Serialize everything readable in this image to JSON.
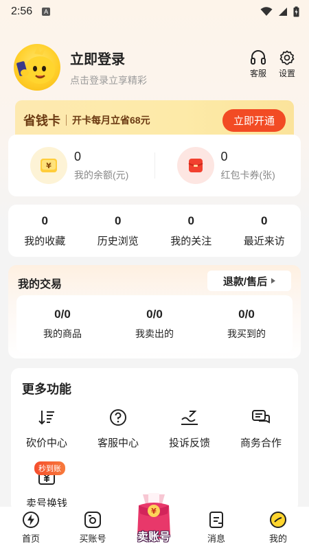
{
  "status_bar": {
    "time": "2:56",
    "notif_letter": "A"
  },
  "profile": {
    "title": "立即登录",
    "subtitle": "点击登录立享精彩"
  },
  "top_actions": [
    {
      "label": "客服",
      "icon": "headset-icon"
    },
    {
      "label": "设置",
      "icon": "gear-icon"
    }
  ],
  "vip": {
    "title": "省钱卡",
    "desc": "开卡每月立省68元",
    "button": "立即开通",
    "accent": "#f24b24"
  },
  "balances": [
    {
      "value": "0",
      "label": "我的余额(元)",
      "icon": "yuan-wallet-icon"
    },
    {
      "value": "0",
      "label": "红包卡券(张)",
      "icon": "red-envelope-icon"
    }
  ],
  "stats": [
    {
      "value": "0",
      "label": "我的收藏"
    },
    {
      "value": "0",
      "label": "历史浏览"
    },
    {
      "value": "0",
      "label": "我的关注"
    },
    {
      "value": "0",
      "label": "最近来访"
    }
  ],
  "trade": {
    "title": "我的交易",
    "refund_button": "退款/售后",
    "items": [
      {
        "value": "0/0",
        "label": "我的商品"
      },
      {
        "value": "0/0",
        "label": "我卖出的"
      },
      {
        "value": "0/0",
        "label": "我买到的"
      }
    ]
  },
  "more": {
    "title": "更多功能",
    "items": [
      {
        "label": "砍价中心",
        "icon": "bargain-icon"
      },
      {
        "label": "客服中心",
        "icon": "help-icon"
      },
      {
        "label": "投诉反馈",
        "icon": "feedback-icon"
      },
      {
        "label": "商务合作",
        "icon": "chat-icon"
      },
      {
        "label": "卖号换钱",
        "icon": "sell-cash-icon"
      }
    ],
    "badge": "秒到账"
  },
  "nav": {
    "items": [
      {
        "label": "首页",
        "icon": "lightning-icon"
      },
      {
        "label": "买账号",
        "icon": "buy-icon"
      },
      {
        "label": "消息",
        "icon": "message-icon"
      },
      {
        "label": "我的",
        "icon": "profile-icon"
      }
    ],
    "sell_label": "卖账号"
  }
}
